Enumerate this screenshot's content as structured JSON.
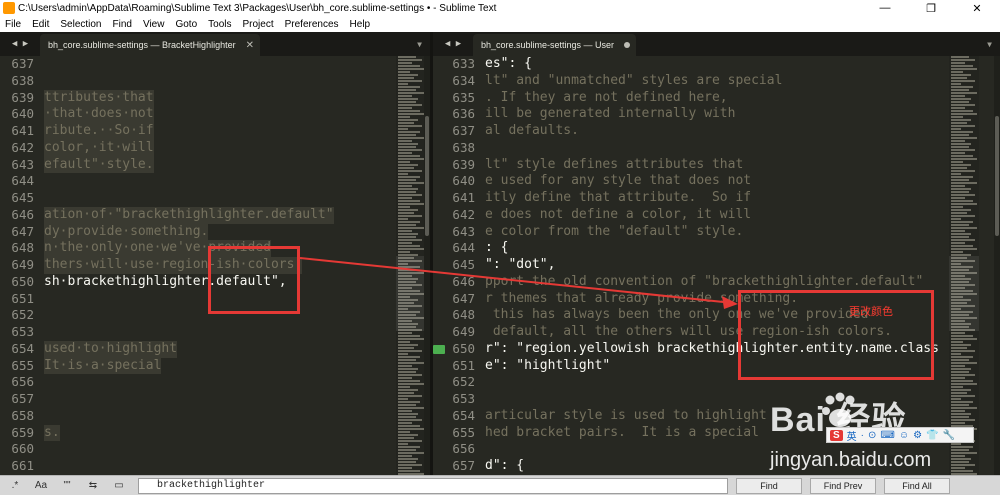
{
  "window": {
    "title": "C:\\Users\\admin\\AppData\\Roaming\\Sublime Text 3\\Packages\\User\\bh_core.sublime-settings • - Sublime Text",
    "minimize_glyph": "—",
    "maximize_glyph": "❐",
    "close_glyph": "✕"
  },
  "menu": {
    "items": [
      "File",
      "Edit",
      "Selection",
      "Find",
      "View",
      "Goto",
      "Tools",
      "Project",
      "Preferences",
      "Help"
    ]
  },
  "tabs": {
    "left": {
      "label": "bh_core.sublime-settings — BracketHighlighter",
      "close": "✕"
    },
    "right": {
      "label": "bh_core.sublime-settings — User"
    },
    "arrows": "◀ ▶",
    "dropdown": "▼"
  },
  "left_pane": {
    "lines": [
      {
        "num": "637",
        "text": ""
      },
      {
        "num": "638",
        "text": ""
      },
      {
        "num": "639",
        "text": "ttributes·that",
        "style": "c-comment-hl"
      },
      {
        "num": "640",
        "text": "·that·does·not",
        "style": "c-comment-hl"
      },
      {
        "num": "641",
        "text": "ribute.··So·if",
        "style": "c-comment-hl"
      },
      {
        "num": "642",
        "text": "color,·it·will",
        "style": "c-comment-hl"
      },
      {
        "num": "643",
        "text": "efault\"·style.",
        "style": "c-comment-hl"
      },
      {
        "num": "644",
        "text": ""
      },
      {
        "num": "645",
        "text": ""
      },
      {
        "num": "646",
        "text": "ation·of·\"brackethighlighter.default\"",
        "style": "c-comment-hl"
      },
      {
        "num": "647",
        "text": "dy·provide·something.",
        "style": "c-comment-hl"
      },
      {
        "num": "648",
        "text": "n·the·only·one·we've·provided",
        "style": "c-comment-hl"
      },
      {
        "num": "649",
        "text": "thers·will·use·region-ish·colors.",
        "style": "c-comment-hl"
      },
      {
        "num": "650",
        "text": "sh·brackethighlighter.default\",",
        "style": "c-text"
      },
      {
        "num": "651",
        "text": ""
      },
      {
        "num": "652",
        "text": ""
      },
      {
        "num": "653",
        "text": ""
      },
      {
        "num": "654",
        "text": "used·to·highlight",
        "style": "c-comment-hl"
      },
      {
        "num": "655",
        "text": "It·is·a·special",
        "style": "c-comment-hl"
      },
      {
        "num": "656",
        "text": ""
      },
      {
        "num": "657",
        "text": ""
      },
      {
        "num": "658",
        "text": ""
      },
      {
        "num": "659",
        "text": "s.",
        "style": "c-comment-hl"
      },
      {
        "num": "660",
        "text": ""
      },
      {
        "num": "661",
        "text": ""
      }
    ]
  },
  "right_pane": {
    "lines": [
      {
        "num": "633",
        "text": "es\": {",
        "style": "c-text"
      },
      {
        "num": "634",
        "text": "lt\" and \"unmatched\" styles are special",
        "style": "c-comment"
      },
      {
        "num": "635",
        "text": ". If they are not defined here,",
        "style": "c-comment"
      },
      {
        "num": "636",
        "text": "ill be generated internally with",
        "style": "c-comment"
      },
      {
        "num": "637",
        "text": "al defaults.",
        "style": "c-comment"
      },
      {
        "num": "638",
        "text": ""
      },
      {
        "num": "639",
        "text": "lt\" style defines attributes that",
        "style": "c-comment"
      },
      {
        "num": "640",
        "text": "e used for any style that does not",
        "style": "c-comment"
      },
      {
        "num": "641",
        "text": "itly define that attribute.  So if",
        "style": "c-comment"
      },
      {
        "num": "642",
        "text": "e does not define a color, it will",
        "style": "c-comment"
      },
      {
        "num": "643",
        "text": "e color from the \"default\" style.",
        "style": "c-comment"
      },
      {
        "num": "644",
        "text": ": {",
        "style": "c-text"
      },
      {
        "num": "645",
        "text": "\": \"dot\",",
        "style": "c-text"
      },
      {
        "num": "646",
        "text": "pport the old convention of \"brackethighlighter.default\"",
        "style": "c-comment"
      },
      {
        "num": "647",
        "text": "r themes that already provide something.",
        "style": "c-comment"
      },
      {
        "num": "648",
        "text": " this has always been the only one we've provided",
        "style": "c-comment"
      },
      {
        "num": "649",
        "text": " default, all the others will use region-ish colors.",
        "style": "c-comment"
      },
      {
        "num": "650",
        "text": "r\": \"region.yellowish brackethighlighter.entity.name.class\"",
        "style": "c-text"
      },
      {
        "num": "651",
        "text": "e\": \"hightlight\"",
        "style": "c-text"
      },
      {
        "num": "652",
        "text": ""
      },
      {
        "num": "653",
        "text": ""
      },
      {
        "num": "654",
        "text": "articular style is used to highlight",
        "style": "c-comment"
      },
      {
        "num": "655",
        "text": "hed bracket pairs.  It is a special",
        "style": "c-comment"
      },
      {
        "num": "656",
        "text": ""
      },
      {
        "num": "657",
        "text": "d\": {",
        "style": "c-text"
      }
    ]
  },
  "annotation": {
    "label": "更改颜色",
    "color": "#e53935"
  },
  "watermark": {
    "logo": "Bai   经验",
    "url": "jingyan.baidu.com"
  },
  "ime": {
    "s": "S",
    "items": [
      "英",
      "·",
      "⊙",
      "⌨",
      "☺",
      "⚙",
      "👕",
      "🔧"
    ]
  },
  "findbar": {
    "options": [
      ".*",
      "Aa",
      "\"\"",
      "⇆",
      "▭"
    ],
    "input_value": "brackethighlighter",
    "find_label": "Find",
    "find_prev_label": "Find Prev",
    "find_all_label": "Find All"
  },
  "colors": {
    "background": "#272822",
    "comment": "#75715e",
    "string": "#e6db74",
    "text": "#f8f8f2",
    "line_number": "#908f86",
    "accent_red": "#e53935"
  }
}
